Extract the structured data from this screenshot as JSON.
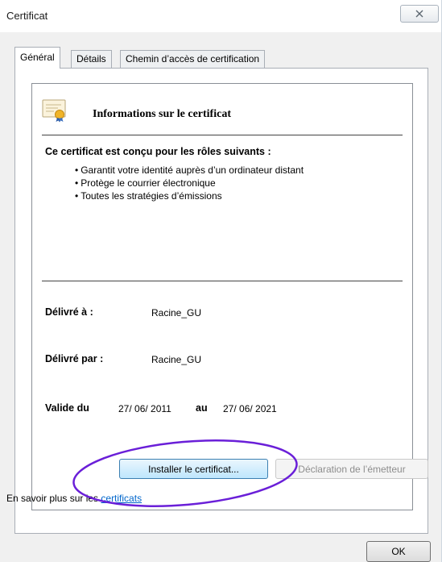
{
  "window": {
    "title": "Certificat",
    "close_glyph": "✕"
  },
  "tabs": [
    {
      "label": "Général",
      "active": true
    },
    {
      "label": "Détails",
      "active": false
    },
    {
      "label": "Chemin d’accès de certification",
      "active": false
    }
  ],
  "info": {
    "icon": "certificate-icon",
    "title": "Informations sur le certificat",
    "purpose_title": "Ce certificat est conçu pour les rôles suivants :",
    "purposes": [
      "Garantit votre identité auprès d’un ordinateur distant",
      "Protège le courrier électronique",
      "Toutes les stratégies d’émissions"
    ],
    "issued_to_label": "Délivré à :",
    "issued_to": "Racine_GU",
    "issued_by_label": "Délivré par :",
    "issued_by": "Racine_GU",
    "valid_from_label": "Valide du",
    "valid_from": "27/ 06/ 2011",
    "valid_to_label": "au",
    "valid_to": "27/ 06/ 2021"
  },
  "buttons": {
    "install": "Installer le certificat...",
    "issuer_statement": "Déclaration de l’émetteur",
    "ok": "OK"
  },
  "learn_more": {
    "prefix": "En savoir plus sur les ",
    "link": "certificats"
  },
  "colors": {
    "annotation_ring": "#6a1fd8",
    "link": "#0066cc",
    "focus_border": "#3c7fb1"
  }
}
